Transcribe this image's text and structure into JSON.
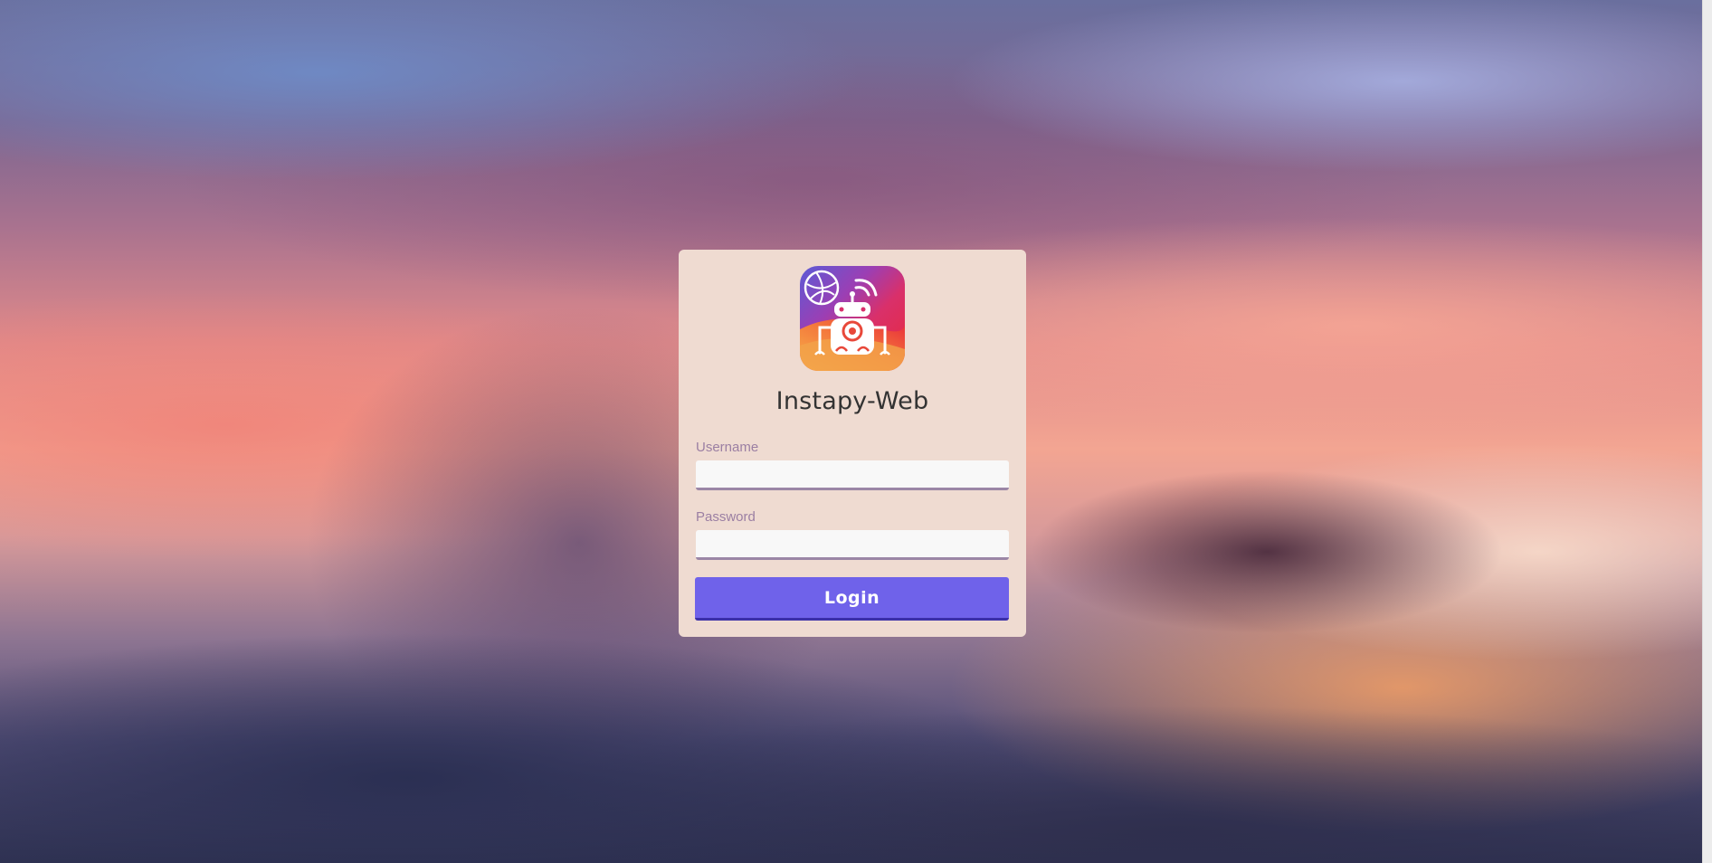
{
  "app": {
    "title": "Instapy-Web",
    "logo_icon": "robot-logo-icon"
  },
  "form": {
    "username_label": "Username",
    "username_value": "",
    "password_label": "Password",
    "password_value": "",
    "login_label": "Login"
  },
  "colors": {
    "card_background": "#efdbd1",
    "button": "#6f62ea",
    "label": "#9b7fa3",
    "input_underline": "#9b86a6"
  }
}
